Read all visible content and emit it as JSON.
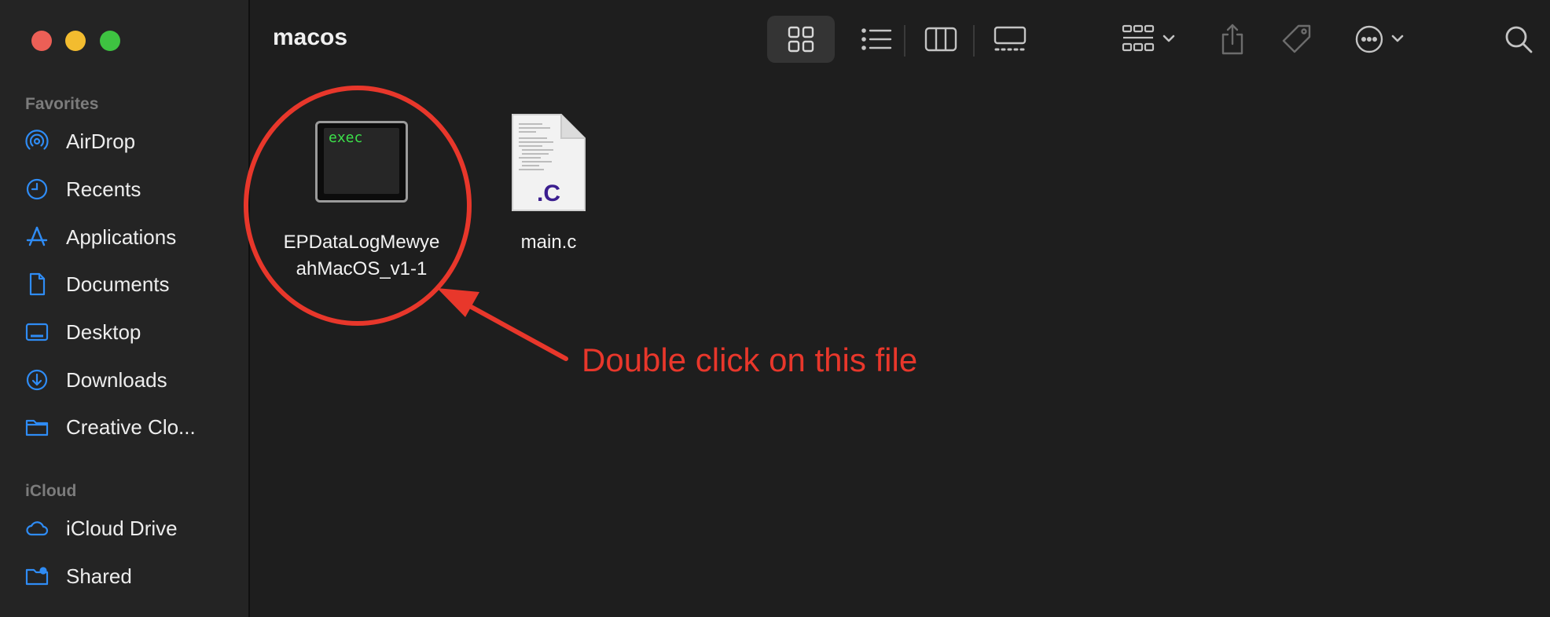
{
  "window": {
    "folder_title": "macos"
  },
  "sidebar": {
    "favorites_label": "Favorites",
    "favorites": [
      {
        "label": "AirDrop",
        "icon": "airdrop-icon"
      },
      {
        "label": "Recents",
        "icon": "clock-icon"
      },
      {
        "label": "Applications",
        "icon": "applications-icon"
      },
      {
        "label": "Documents",
        "icon": "document-icon"
      },
      {
        "label": "Desktop",
        "icon": "desktop-icon"
      },
      {
        "label": "Downloads",
        "icon": "download-icon"
      },
      {
        "label": "Creative Clo...",
        "icon": "folder-icon"
      }
    ],
    "icloud_label": "iCloud",
    "icloud": [
      {
        "label": "iCloud Drive",
        "icon": "cloud-icon"
      },
      {
        "label": "Shared",
        "icon": "shared-folder-icon"
      }
    ]
  },
  "toolbar": {
    "buttons": [
      "icon-view",
      "list-view",
      "column-view",
      "gallery-view",
      "group-by",
      "share",
      "tags",
      "more-actions",
      "search"
    ],
    "active_view": "icon-view"
  },
  "files": [
    {
      "name": "EPDataLogMewyeahMacOS_v1-1",
      "name_line1": "EPDataLogMewye",
      "name_line2": "ahMacOS_v1-1",
      "type": "executable",
      "icon_text": "exec"
    },
    {
      "name": "main.c",
      "type": "c-source",
      "icon_text": ".C"
    }
  ],
  "annotation": {
    "text": "Double click on this file",
    "color": "#e8372b"
  },
  "colors": {
    "accent": "#2f8cf5",
    "annotation": "#e8372b",
    "exec_text": "#3ce04a",
    "c_ext": "#3b1e8f"
  }
}
